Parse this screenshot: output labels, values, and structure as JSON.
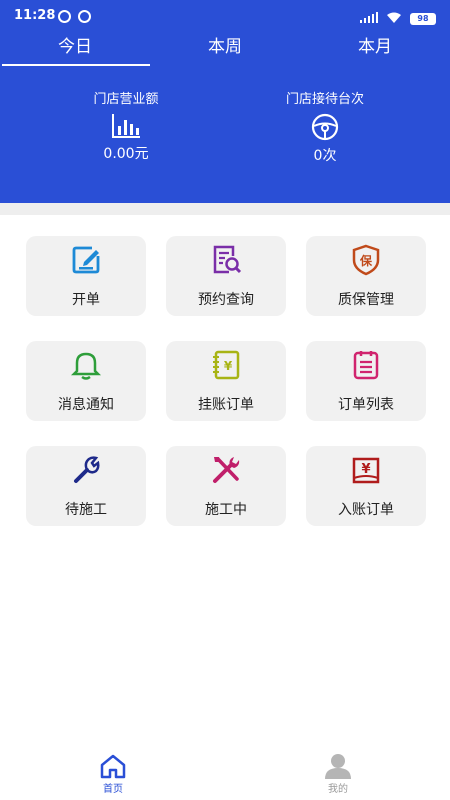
{
  "status_bar": {
    "time": "11:28",
    "signal": "⁺ᵢₗₗ",
    "battery": "98"
  },
  "tabs": [
    {
      "label": "今日"
    },
    {
      "label": "本周"
    },
    {
      "label": "本月"
    }
  ],
  "stats": [
    {
      "label": "门店营业额",
      "value": "0.00元",
      "icon": "bar-chart-icon"
    },
    {
      "label": "门店接待台次",
      "value": "0次",
      "icon": "steering-wheel-icon"
    }
  ],
  "menu": [
    {
      "label": "开单",
      "icon": "edit-document-icon",
      "color": "#1e8ad6"
    },
    {
      "label": "预约查询",
      "icon": "document-search-icon",
      "color": "#7a2ea8"
    },
    {
      "label": "质保管理",
      "icon": "warranty-shield-icon",
      "color": "#c04a1a"
    },
    {
      "label": "消息通知",
      "icon": "bell-icon",
      "color": "#2e9e3a"
    },
    {
      "label": "挂账订单",
      "icon": "yen-notebook-icon",
      "color": "#a8b414"
    },
    {
      "label": "订单列表",
      "icon": "order-list-icon",
      "color": "#d0246e"
    },
    {
      "label": "待施工",
      "icon": "wrench-icon",
      "color": "#1e2a8a"
    },
    {
      "label": "施工中",
      "icon": "tools-crossed-icon",
      "color": "#c01f6a"
    },
    {
      "label": "入账订单",
      "icon": "yen-book-icon",
      "color": "#b01c1c"
    }
  ],
  "bottom_nav": [
    {
      "label": "首页",
      "icon": "home-icon",
      "active": true,
      "color": "#2a4fd6"
    },
    {
      "label": "我的",
      "icon": "user-icon",
      "active": false,
      "color": "#9a9a9a"
    }
  ],
  "colors": {
    "header_bg": "#2a4fd6",
    "tile_bg": "#f1f1f1"
  }
}
